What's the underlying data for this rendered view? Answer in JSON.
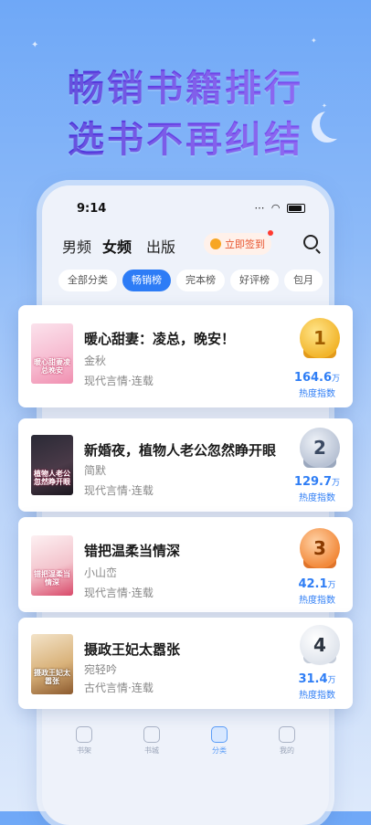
{
  "headline": {
    "line1": "畅销书籍排行",
    "line2": "选书不再纠结"
  },
  "status_bar": {
    "time": "9:14"
  },
  "top_tabs": [
    "男频",
    "女频",
    "出版"
  ],
  "checkin_label": "立即签到",
  "filter_chips": [
    "全部分类",
    "畅销榜",
    "完本榜",
    "好评榜",
    "包月"
  ],
  "books": [
    {
      "rank": "1",
      "title": "暖心甜妻：凌总，晚安！",
      "author": "金秋",
      "tags": "现代言情·连载",
      "heat": "164.6",
      "unit": "万",
      "heat_label": "热度指数",
      "cover_text": "暖心甜妻凌总晚安"
    },
    {
      "rank": "2",
      "title": "新婚夜，植物人老公忽然睁开眼",
      "author": "简默",
      "tags": "现代言情·连载",
      "heat": "129.7",
      "unit": "万",
      "heat_label": "热度指数",
      "cover_text": "植物人老公忽然睁开眼"
    },
    {
      "rank": "3",
      "title": "错把温柔当情深",
      "author": "小山峦",
      "tags": "现代言情·连载",
      "heat": "42.1",
      "unit": "万",
      "heat_label": "热度指数",
      "cover_text": "错把温柔当情深"
    },
    {
      "rank": "4",
      "title": "摄政王妃太嚣张",
      "author": "宛轻吟",
      "tags": "古代言情·连载",
      "heat": "31.4",
      "unit": "万",
      "heat_label": "热度指数",
      "cover_text": "摄政王妃太嚣张"
    }
  ],
  "bottom_tabs": [
    "书架",
    "书城",
    "分类",
    "我的"
  ],
  "colors": {
    "accent": "#2d7cf6",
    "gold": "#f2b52c",
    "silver": "#b8c2d4",
    "bronze": "#f28a3c"
  }
}
